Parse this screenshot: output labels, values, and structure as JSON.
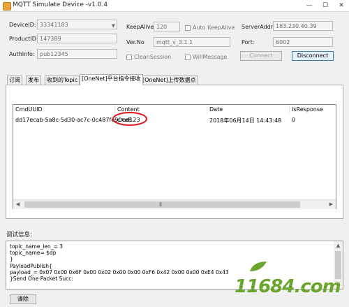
{
  "window": {
    "title": "MQTT Simulate Device  -v1.0.4",
    "min": "—",
    "max": "☐",
    "close": "✕"
  },
  "conn": {
    "device_id_label": "DeviceID:",
    "device_id_value": "33341183",
    "product_id_label": "ProductID:",
    "product_id_value": "147389",
    "auth_info_label": "AuthInfo:",
    "auth_info_value": "pub12345",
    "keepalive_label": "KeepAlive:",
    "keepalive_value": "120",
    "auto_keepalive_label": "Auto KeepAlive",
    "ver_label": "Ver.No",
    "ver_value": "mqtt_v_3.1.1",
    "clean_session_label": "CleanSession",
    "will_message_label": "WillMessage",
    "server_addr_label": "ServerAddr:",
    "server_addr_value": "183.230.40.39",
    "port_label": "Port:",
    "port_value": "6002",
    "connect_label": "Connect",
    "disconnect_label": "Disconnect"
  },
  "tabs": [
    "订阅",
    "发布",
    "收到的Topic",
    "[OneNet]平台指令接收",
    "[OneNet]上传数据点"
  ],
  "active_tab": 3,
  "table": {
    "columns": [
      "CmdUUID",
      "Content",
      "Date",
      "IsResponse"
    ],
    "rows": [
      [
        "dd17ecab-5a8c-5d30-ac7c-0c487fe90ce8",
        "cmd123",
        "2018年06月14日 14:43:48",
        "0"
      ]
    ]
  },
  "highlight_color": "#e0191c",
  "debug": {
    "label": "调试信息:",
    "lines": [
      "topic_name_len_= 3",
      "topic_name= $dp",
      "}",
      "PayloadPublish{",
      "payload_= 0x07 0x00 0x6F 0x00 0x02 0x00 0x00 0xF6 0x42 0x00 0x00 0xE4 0x43",
      "}Send One Packet Succ:"
    ],
    "clear_label": "清除"
  },
  "watermark": {
    "text": "11684.com",
    "color": "#6aa52c"
  }
}
